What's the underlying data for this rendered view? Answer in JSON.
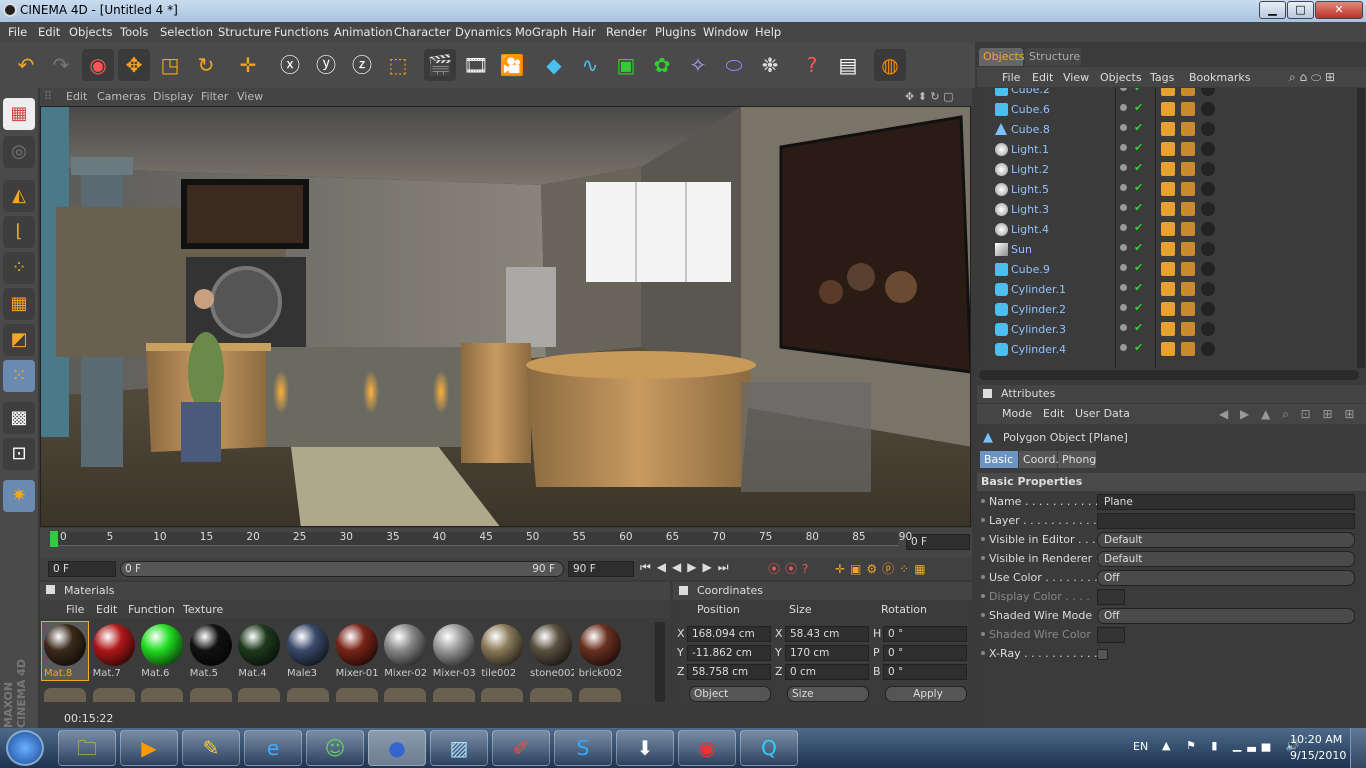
{
  "window": {
    "title": "CINEMA 4D - [Untitled 4 *]",
    "min": "▁",
    "max": "□",
    "close": "✕"
  },
  "menu": [
    "File",
    "Edit",
    "Objects",
    "Tools",
    "Selection",
    "Structure",
    "Functions",
    "Animation",
    "Character",
    "Dynamics",
    "MoGraph",
    "Hair",
    "Render",
    "Plugins",
    "Window",
    "Help"
  ],
  "viewport": {
    "menu": [
      "Edit",
      "Cameras",
      "Display",
      "Filter",
      "View"
    ]
  },
  "timeline": {
    "ticks": [
      "0",
      "5",
      "10",
      "15",
      "20",
      "25",
      "30",
      "35",
      "40",
      "45",
      "50",
      "55",
      "60",
      "65",
      "70",
      "75",
      "80",
      "85",
      "90"
    ],
    "current_frame": "0 F",
    "start_field": "0 F",
    "range_start": "0 F",
    "range_end": "90 F",
    "end_field": "90 F"
  },
  "materials": {
    "title": "Materials",
    "menu": [
      "File",
      "Edit",
      "Function",
      "Texture"
    ],
    "items": [
      {
        "name": "Mat.8",
        "color": "#3a2a1a",
        "selected": true
      },
      {
        "name": "Mat.7",
        "color": "#b01818"
      },
      {
        "name": "Mat.6",
        "color": "#22dd22"
      },
      {
        "name": "Mat.5",
        "color": "#111111"
      },
      {
        "name": "Mat.4",
        "color": "#1e3a1e"
      },
      {
        "name": "Male3",
        "color": "#3a4a6a"
      },
      {
        "name": "Mixer-01",
        "color": "#7a2418"
      },
      {
        "name": "Mixer-02",
        "color": "#888888"
      },
      {
        "name": "Mixer-03",
        "color": "#9a9a9a"
      },
      {
        "name": "tile002",
        "color": "#8a7a5a"
      },
      {
        "name": "stone002",
        "color": "#5a5040"
      },
      {
        "name": "brick002",
        "color": "#6a3020"
      }
    ]
  },
  "coordinates": {
    "title": "Coordinates",
    "headers": [
      "Position",
      "Size",
      "Rotation"
    ],
    "rows": [
      {
        "axis": "X",
        "pos": "168.094 cm",
        "saxis": "X",
        "size": "58.43 cm",
        "raxis": "H",
        "rot": "0 °"
      },
      {
        "axis": "Y",
        "pos": "-11.862 cm",
        "saxis": "Y",
        "size": "170 cm",
        "raxis": "P",
        "rot": "0 °"
      },
      {
        "axis": "Z",
        "pos": "58.758 cm",
        "saxis": "Z",
        "size": "0 cm",
        "raxis": "B",
        "rot": "0 °"
      }
    ],
    "mode": "Object",
    "size_mode": "Size",
    "apply": "Apply"
  },
  "objects": {
    "tabs": [
      "Objects",
      "Structure"
    ],
    "menu": [
      "File",
      "Edit",
      "View",
      "Objects",
      "Tags",
      "Bookmarks"
    ],
    "rows": [
      {
        "name": "Cube.2",
        "icon": "cube"
      },
      {
        "name": "Cube.6",
        "icon": "cube"
      },
      {
        "name": "Cube.8",
        "icon": "poly"
      },
      {
        "name": "Light.1",
        "icon": "light"
      },
      {
        "name": "Light.2",
        "icon": "light"
      },
      {
        "name": "Light.5",
        "icon": "light"
      },
      {
        "name": "Light.3",
        "icon": "light"
      },
      {
        "name": "Light.4",
        "icon": "light"
      },
      {
        "name": "Sun",
        "icon": "sun"
      },
      {
        "name": "Cube.9",
        "icon": "cube"
      },
      {
        "name": "Cylinder.1",
        "icon": "cyl"
      },
      {
        "name": "Cylinder.2",
        "icon": "cyl"
      },
      {
        "name": "Cylinder.3",
        "icon": "cyl"
      },
      {
        "name": "Cylinder.4",
        "icon": "cyl"
      }
    ]
  },
  "attributes": {
    "title": "Attributes",
    "menu": [
      "Mode",
      "Edit",
      "User Data"
    ],
    "object": "Polygon Object [Plane]",
    "tabs": [
      "Basic",
      "Coord.",
      "Phong"
    ],
    "section": "Basic Properties",
    "rows": [
      {
        "label": "Name . . . . . . . . . . . .",
        "value": "Plane"
      },
      {
        "label": "Layer . . . . . . . . . . . .",
        "value": ""
      },
      {
        "label": "Visible in Editor . . . . .",
        "value": "Default"
      },
      {
        "label": "Visible in Renderer . .",
        "value": "Default"
      },
      {
        "label": "Use Color . . . . . . . . .",
        "value": "Off"
      },
      {
        "label": "Display Color . . . .",
        "value": ""
      },
      {
        "label": "Shaded Wire Mode",
        "value": "Off"
      },
      {
        "label": "Shaded Wire Color",
        "value": ""
      },
      {
        "label": "X-Ray . . . . . . . . . . . .",
        "value": ""
      }
    ]
  },
  "status": {
    "time": "00:15:22",
    "brand": "MAXON CINEMA 4D"
  },
  "taskbar": {
    "lang": "EN",
    "clock": "10:20 AM",
    "date": "9/15/2010"
  }
}
